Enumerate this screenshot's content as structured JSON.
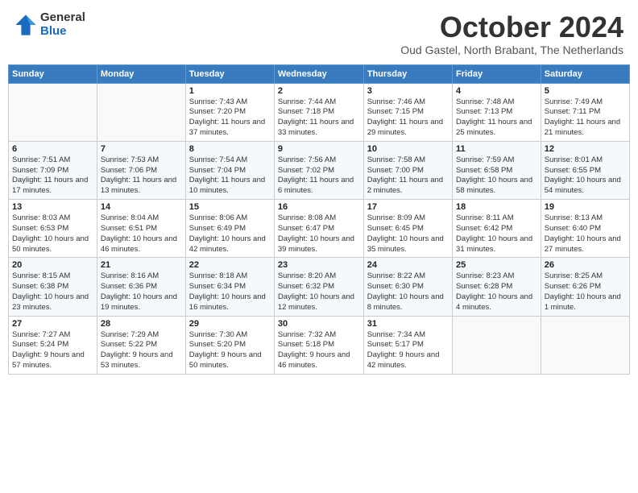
{
  "logo": {
    "general": "General",
    "blue": "Blue"
  },
  "header": {
    "month": "October 2024",
    "location": "Oud Gastel, North Brabant, The Netherlands"
  },
  "weekdays": [
    "Sunday",
    "Monday",
    "Tuesday",
    "Wednesday",
    "Thursday",
    "Friday",
    "Saturday"
  ],
  "weeks": [
    [
      {
        "day": "",
        "info": ""
      },
      {
        "day": "",
        "info": ""
      },
      {
        "day": "1",
        "info": "Sunrise: 7:43 AM\nSunset: 7:20 PM\nDaylight: 11 hours and 37 minutes."
      },
      {
        "day": "2",
        "info": "Sunrise: 7:44 AM\nSunset: 7:18 PM\nDaylight: 11 hours and 33 minutes."
      },
      {
        "day": "3",
        "info": "Sunrise: 7:46 AM\nSunset: 7:15 PM\nDaylight: 11 hours and 29 minutes."
      },
      {
        "day": "4",
        "info": "Sunrise: 7:48 AM\nSunset: 7:13 PM\nDaylight: 11 hours and 25 minutes."
      },
      {
        "day": "5",
        "info": "Sunrise: 7:49 AM\nSunset: 7:11 PM\nDaylight: 11 hours and 21 minutes."
      }
    ],
    [
      {
        "day": "6",
        "info": "Sunrise: 7:51 AM\nSunset: 7:09 PM\nDaylight: 11 hours and 17 minutes."
      },
      {
        "day": "7",
        "info": "Sunrise: 7:53 AM\nSunset: 7:06 PM\nDaylight: 11 hours and 13 minutes."
      },
      {
        "day": "8",
        "info": "Sunrise: 7:54 AM\nSunset: 7:04 PM\nDaylight: 11 hours and 10 minutes."
      },
      {
        "day": "9",
        "info": "Sunrise: 7:56 AM\nSunset: 7:02 PM\nDaylight: 11 hours and 6 minutes."
      },
      {
        "day": "10",
        "info": "Sunrise: 7:58 AM\nSunset: 7:00 PM\nDaylight: 11 hours and 2 minutes."
      },
      {
        "day": "11",
        "info": "Sunrise: 7:59 AM\nSunset: 6:58 PM\nDaylight: 10 hours and 58 minutes."
      },
      {
        "day": "12",
        "info": "Sunrise: 8:01 AM\nSunset: 6:55 PM\nDaylight: 10 hours and 54 minutes."
      }
    ],
    [
      {
        "day": "13",
        "info": "Sunrise: 8:03 AM\nSunset: 6:53 PM\nDaylight: 10 hours and 50 minutes."
      },
      {
        "day": "14",
        "info": "Sunrise: 8:04 AM\nSunset: 6:51 PM\nDaylight: 10 hours and 46 minutes."
      },
      {
        "day": "15",
        "info": "Sunrise: 8:06 AM\nSunset: 6:49 PM\nDaylight: 10 hours and 42 minutes."
      },
      {
        "day": "16",
        "info": "Sunrise: 8:08 AM\nSunset: 6:47 PM\nDaylight: 10 hours and 39 minutes."
      },
      {
        "day": "17",
        "info": "Sunrise: 8:09 AM\nSunset: 6:45 PM\nDaylight: 10 hours and 35 minutes."
      },
      {
        "day": "18",
        "info": "Sunrise: 8:11 AM\nSunset: 6:42 PM\nDaylight: 10 hours and 31 minutes."
      },
      {
        "day": "19",
        "info": "Sunrise: 8:13 AM\nSunset: 6:40 PM\nDaylight: 10 hours and 27 minutes."
      }
    ],
    [
      {
        "day": "20",
        "info": "Sunrise: 8:15 AM\nSunset: 6:38 PM\nDaylight: 10 hours and 23 minutes."
      },
      {
        "day": "21",
        "info": "Sunrise: 8:16 AM\nSunset: 6:36 PM\nDaylight: 10 hours and 19 minutes."
      },
      {
        "day": "22",
        "info": "Sunrise: 8:18 AM\nSunset: 6:34 PM\nDaylight: 10 hours and 16 minutes."
      },
      {
        "day": "23",
        "info": "Sunrise: 8:20 AM\nSunset: 6:32 PM\nDaylight: 10 hours and 12 minutes."
      },
      {
        "day": "24",
        "info": "Sunrise: 8:22 AM\nSunset: 6:30 PM\nDaylight: 10 hours and 8 minutes."
      },
      {
        "day": "25",
        "info": "Sunrise: 8:23 AM\nSunset: 6:28 PM\nDaylight: 10 hours and 4 minutes."
      },
      {
        "day": "26",
        "info": "Sunrise: 8:25 AM\nSunset: 6:26 PM\nDaylight: 10 hours and 1 minute."
      }
    ],
    [
      {
        "day": "27",
        "info": "Sunrise: 7:27 AM\nSunset: 5:24 PM\nDaylight: 9 hours and 57 minutes."
      },
      {
        "day": "28",
        "info": "Sunrise: 7:29 AM\nSunset: 5:22 PM\nDaylight: 9 hours and 53 minutes."
      },
      {
        "day": "29",
        "info": "Sunrise: 7:30 AM\nSunset: 5:20 PM\nDaylight: 9 hours and 50 minutes."
      },
      {
        "day": "30",
        "info": "Sunrise: 7:32 AM\nSunset: 5:18 PM\nDaylight: 9 hours and 46 minutes."
      },
      {
        "day": "31",
        "info": "Sunrise: 7:34 AM\nSunset: 5:17 PM\nDaylight: 9 hours and 42 minutes."
      },
      {
        "day": "",
        "info": ""
      },
      {
        "day": "",
        "info": ""
      }
    ]
  ]
}
